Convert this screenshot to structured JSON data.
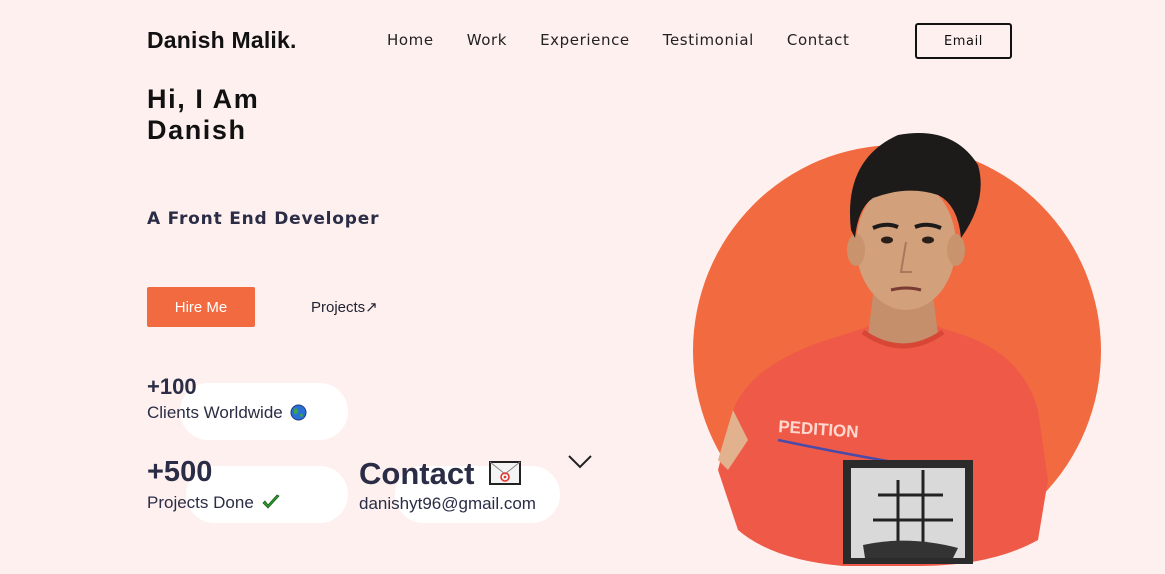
{
  "header": {
    "logo": "Danish Malik.",
    "nav": [
      "Home",
      "Work",
      "Experience",
      "Testimonial",
      "Contact"
    ],
    "email_button": "Email"
  },
  "hero": {
    "greeting_line1": "Hi, I Am",
    "greeting_line2": "Danish",
    "role": "A Front End Developer",
    "hire_button": "Hire Me",
    "projects_link": "Projects↗"
  },
  "stats": [
    {
      "number": "+100",
      "label": "Clients Worldwide",
      "icon": "globe-icon"
    },
    {
      "number": "+500",
      "label": "Projects Done",
      "icon": "checkmark-icon"
    }
  ],
  "contact": {
    "title": "Contact",
    "email": "danishyt96@gmail.com",
    "icon": "envelope-icon"
  },
  "portrait": {
    "shirt_text": "PEDITION"
  },
  "colors": {
    "accent": "#f26a3f",
    "background": "#fff0f0",
    "text": "#2a2d45"
  }
}
